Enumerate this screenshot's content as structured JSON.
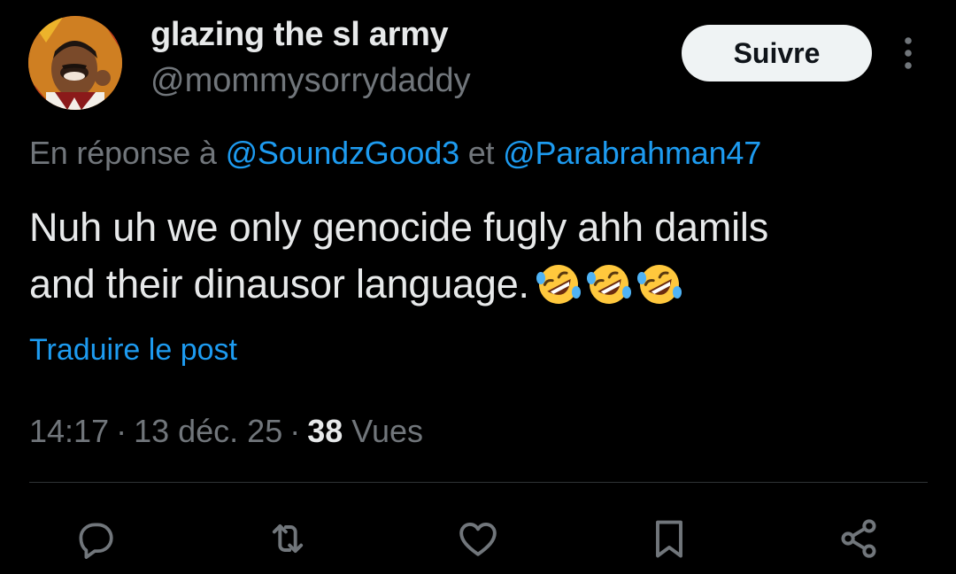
{
  "author": {
    "display_name": "glazing the sl army",
    "handle": "@mommysorrydaddy"
  },
  "follow_button_label": "Suivre",
  "reply": {
    "prefix": "En réponse à ",
    "mention_1": "@SoundzGood3",
    "connector": " et ",
    "mention_2": "@Parabrahman47"
  },
  "tweet": {
    "line_1": "Nuh uh we only genocide fugly ahh damils",
    "line_2": "and their dinausor language.",
    "emojis": [
      "rolling-on-floor-laughing",
      "rolling-on-floor-laughing",
      "rolling-on-floor-laughing"
    ]
  },
  "translate_label": "Traduire le post",
  "meta": {
    "time": "14:17",
    "separator": "·",
    "date": "13 déc. 25",
    "views_count": "38",
    "views_label": "Vues"
  },
  "actions": [
    "reply-icon",
    "retweet-icon",
    "like-icon",
    "bookmark-icon",
    "share-icon"
  ],
  "colors": {
    "background": "#000000",
    "text_primary": "#e7e9ea",
    "text_secondary": "#71767b",
    "link": "#1d9bf0",
    "follow_button_bg": "#eff3f4",
    "divider": "#2f3336"
  }
}
